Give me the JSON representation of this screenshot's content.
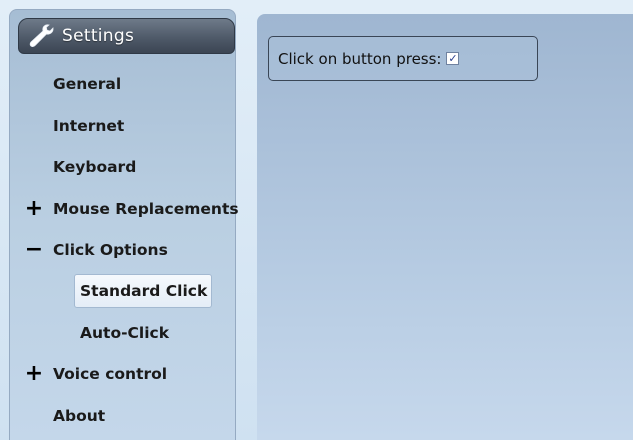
{
  "sidebar": {
    "header": {
      "icon": "wrench-icon",
      "title": "Settings"
    },
    "items": [
      {
        "label": "General",
        "sign": ""
      },
      {
        "label": "Internet",
        "sign": ""
      },
      {
        "label": "Keyboard",
        "sign": ""
      },
      {
        "label": "Mouse Replacements",
        "sign": "+"
      },
      {
        "label": "Click Options",
        "sign": "−"
      },
      {
        "label": "Standard Click",
        "sign": "",
        "selected": true
      },
      {
        "label": "Auto-Click",
        "sign": ""
      },
      {
        "label": "Voice control",
        "sign": "+"
      },
      {
        "label": "About",
        "sign": ""
      }
    ]
  },
  "main": {
    "option": {
      "label": "Click on button press:",
      "checked": true,
      "check_glyph": "✓"
    }
  },
  "colors": {
    "header_bg": "#4f5a69",
    "sidebar_bg": "#bacfe2",
    "main_bg": "#b6cbe2",
    "check_color": "#2a3f8f"
  }
}
